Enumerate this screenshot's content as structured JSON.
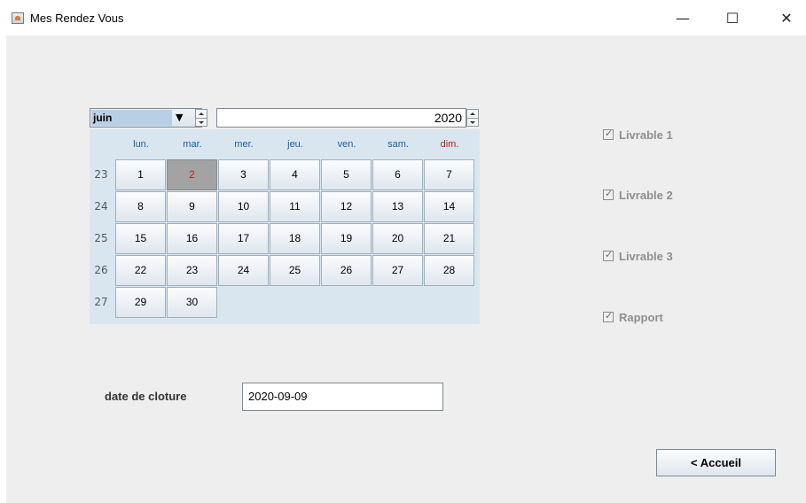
{
  "window": {
    "title": "Mes Rendez Vous",
    "minimize_glyph": "—",
    "maximize_glyph": "☐",
    "close_glyph": "✕"
  },
  "calendar": {
    "month": "juin",
    "year": "2020",
    "weekdays": [
      "lun.",
      "mar.",
      "mer.",
      "jeu.",
      "ven.",
      "sam.",
      "dim."
    ],
    "week_numbers": [
      "23",
      "24",
      "25",
      "26",
      "27"
    ],
    "weeks": [
      [
        "1",
        "2",
        "3",
        "4",
        "5",
        "6",
        "7"
      ],
      [
        "8",
        "9",
        "10",
        "11",
        "12",
        "13",
        "14"
      ],
      [
        "15",
        "16",
        "17",
        "18",
        "19",
        "20",
        "21"
      ],
      [
        "22",
        "23",
        "24",
        "25",
        "26",
        "27",
        "28"
      ],
      [
        "29",
        "30",
        "",
        "",
        "",
        "",
        ""
      ]
    ],
    "selected_day": "2",
    "colors": {
      "weekday": "#1c5fa3",
      "sunday": "#c0181a",
      "selected_bg": "#a3a3a3",
      "selected_text": "#d01a1a"
    }
  },
  "checkboxes": [
    {
      "label": "Livrable 1",
      "checked": true
    },
    {
      "label": "Livrable 2",
      "checked": true
    },
    {
      "label": "Livrable 3",
      "checked": true
    },
    {
      "label": "Rapport",
      "checked": true
    }
  ],
  "form": {
    "date_label": "date de cloture",
    "date_value": "2020-09-09"
  },
  "buttons": {
    "accueil": "< Accueil"
  }
}
